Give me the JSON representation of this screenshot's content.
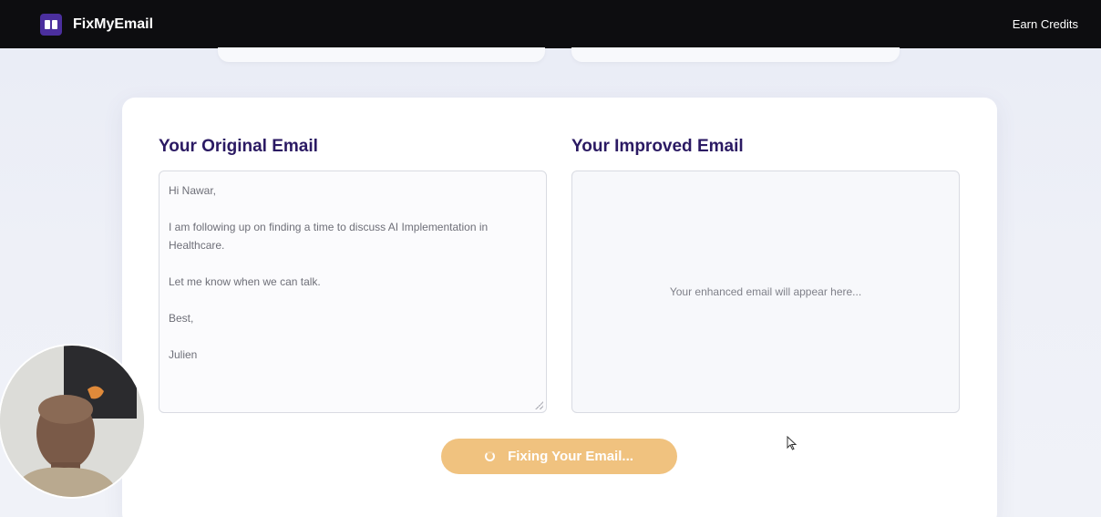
{
  "navbar": {
    "brand": "FixMyEmail",
    "earn_credits": "Earn Credits"
  },
  "original": {
    "title": "Your Original Email",
    "lines": [
      "Hi Nawar,",
      "I am following up on finding a time to discuss AI Implementation in",
      "Healthcare.",
      "Let me know when we can talk.",
      "Best,",
      "Julien"
    ]
  },
  "improved": {
    "title": "Your Improved Email",
    "placeholder": "Your enhanced email will appear here..."
  },
  "action": {
    "label": "Fixing Your Email..."
  },
  "icons": {
    "logo": "book-icon",
    "spinner": "spinner-icon",
    "cursor": "mouse-pointer-icon"
  },
  "colors": {
    "navbar": "#0d0d10",
    "brand_accent": "#4b2f9e",
    "heading": "#2b1a63",
    "button": "#f0c27f"
  }
}
